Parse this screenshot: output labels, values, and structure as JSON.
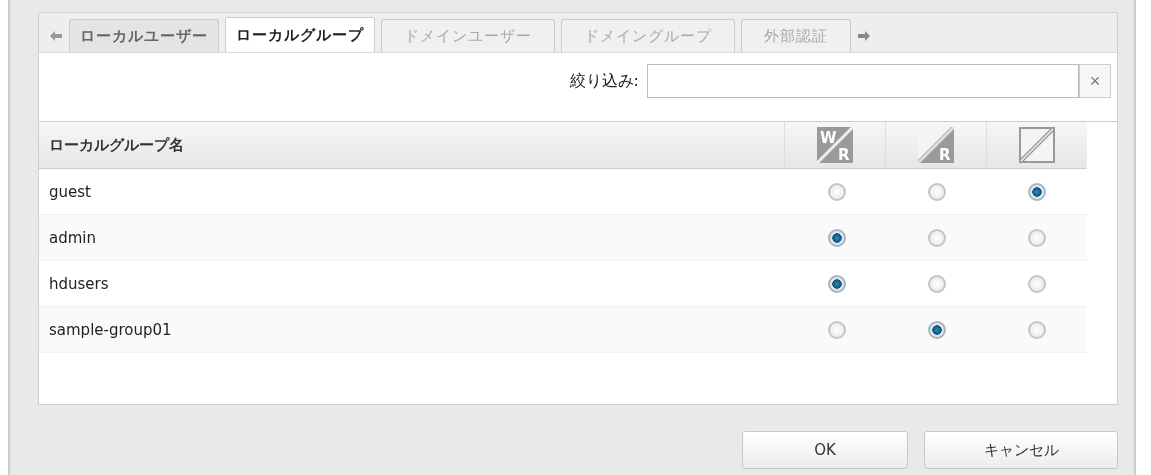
{
  "tabs": [
    {
      "label": "ローカルユーザー",
      "selected": false,
      "disabled": false
    },
    {
      "label": "ローカルグループ",
      "selected": true,
      "disabled": false
    },
    {
      "label": "ドメインユーザー",
      "selected": false,
      "disabled": true
    },
    {
      "label": "ドメイングループ",
      "selected": false,
      "disabled": true
    },
    {
      "label": "外部認証",
      "selected": false,
      "disabled": true
    }
  ],
  "filter": {
    "label": "絞り込み:",
    "clear": "×"
  },
  "table": {
    "name_column": "ローカルグループ名",
    "columns": [
      {
        "kind": "read-write",
        "top": "W",
        "bottom": "R"
      },
      {
        "kind": "read-only",
        "bottom": "R"
      },
      {
        "kind": "none"
      }
    ],
    "rows": [
      {
        "name": "guest",
        "options": [
          {
            "selected": false
          },
          {
            "selected": false
          },
          {
            "selected": true
          }
        ]
      },
      {
        "name": "admin",
        "options": [
          {
            "selected": true
          },
          {
            "selected": false
          },
          {
            "selected": false
          }
        ]
      },
      {
        "name": "hdusers",
        "options": [
          {
            "selected": true
          },
          {
            "selected": false
          },
          {
            "selected": false
          }
        ]
      },
      {
        "name": "sample-group01",
        "options": [
          {
            "selected": false
          },
          {
            "selected": true
          },
          {
            "selected": false
          }
        ]
      }
    ]
  },
  "buttons": [
    "OK",
    "キャンセル"
  ]
}
